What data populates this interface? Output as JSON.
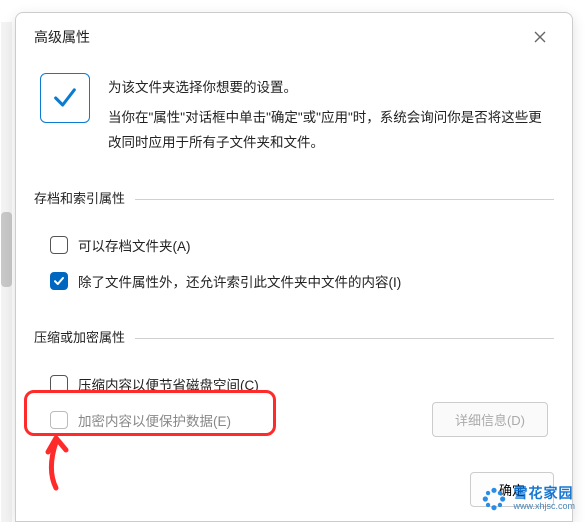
{
  "title": "高级属性",
  "header": {
    "line1": "为该文件夹选择你想要的设置。",
    "line2": "当你在\"属性\"对话框中单击\"确定\"或\"应用\"时，系统会询问你是否将这些更改同时应用于所有子文件夹和文件。"
  },
  "group_archive": {
    "title": "存档和索引属性",
    "opt_archive": "可以存档文件夹(A)",
    "opt_index": "除了文件属性外，还允许索引此文件夹中文件的内容(I)"
  },
  "group_compress": {
    "title": "压缩或加密属性",
    "opt_compress": "压缩内容以便节省磁盘空间(C)",
    "opt_encrypt": "加密内容以便保护数据(E)",
    "btn_details": "详细信息(D)"
  },
  "footer": {
    "ok": "确定"
  },
  "watermark": {
    "name": "雪花家园",
    "url": "www.xhjsc.com"
  }
}
